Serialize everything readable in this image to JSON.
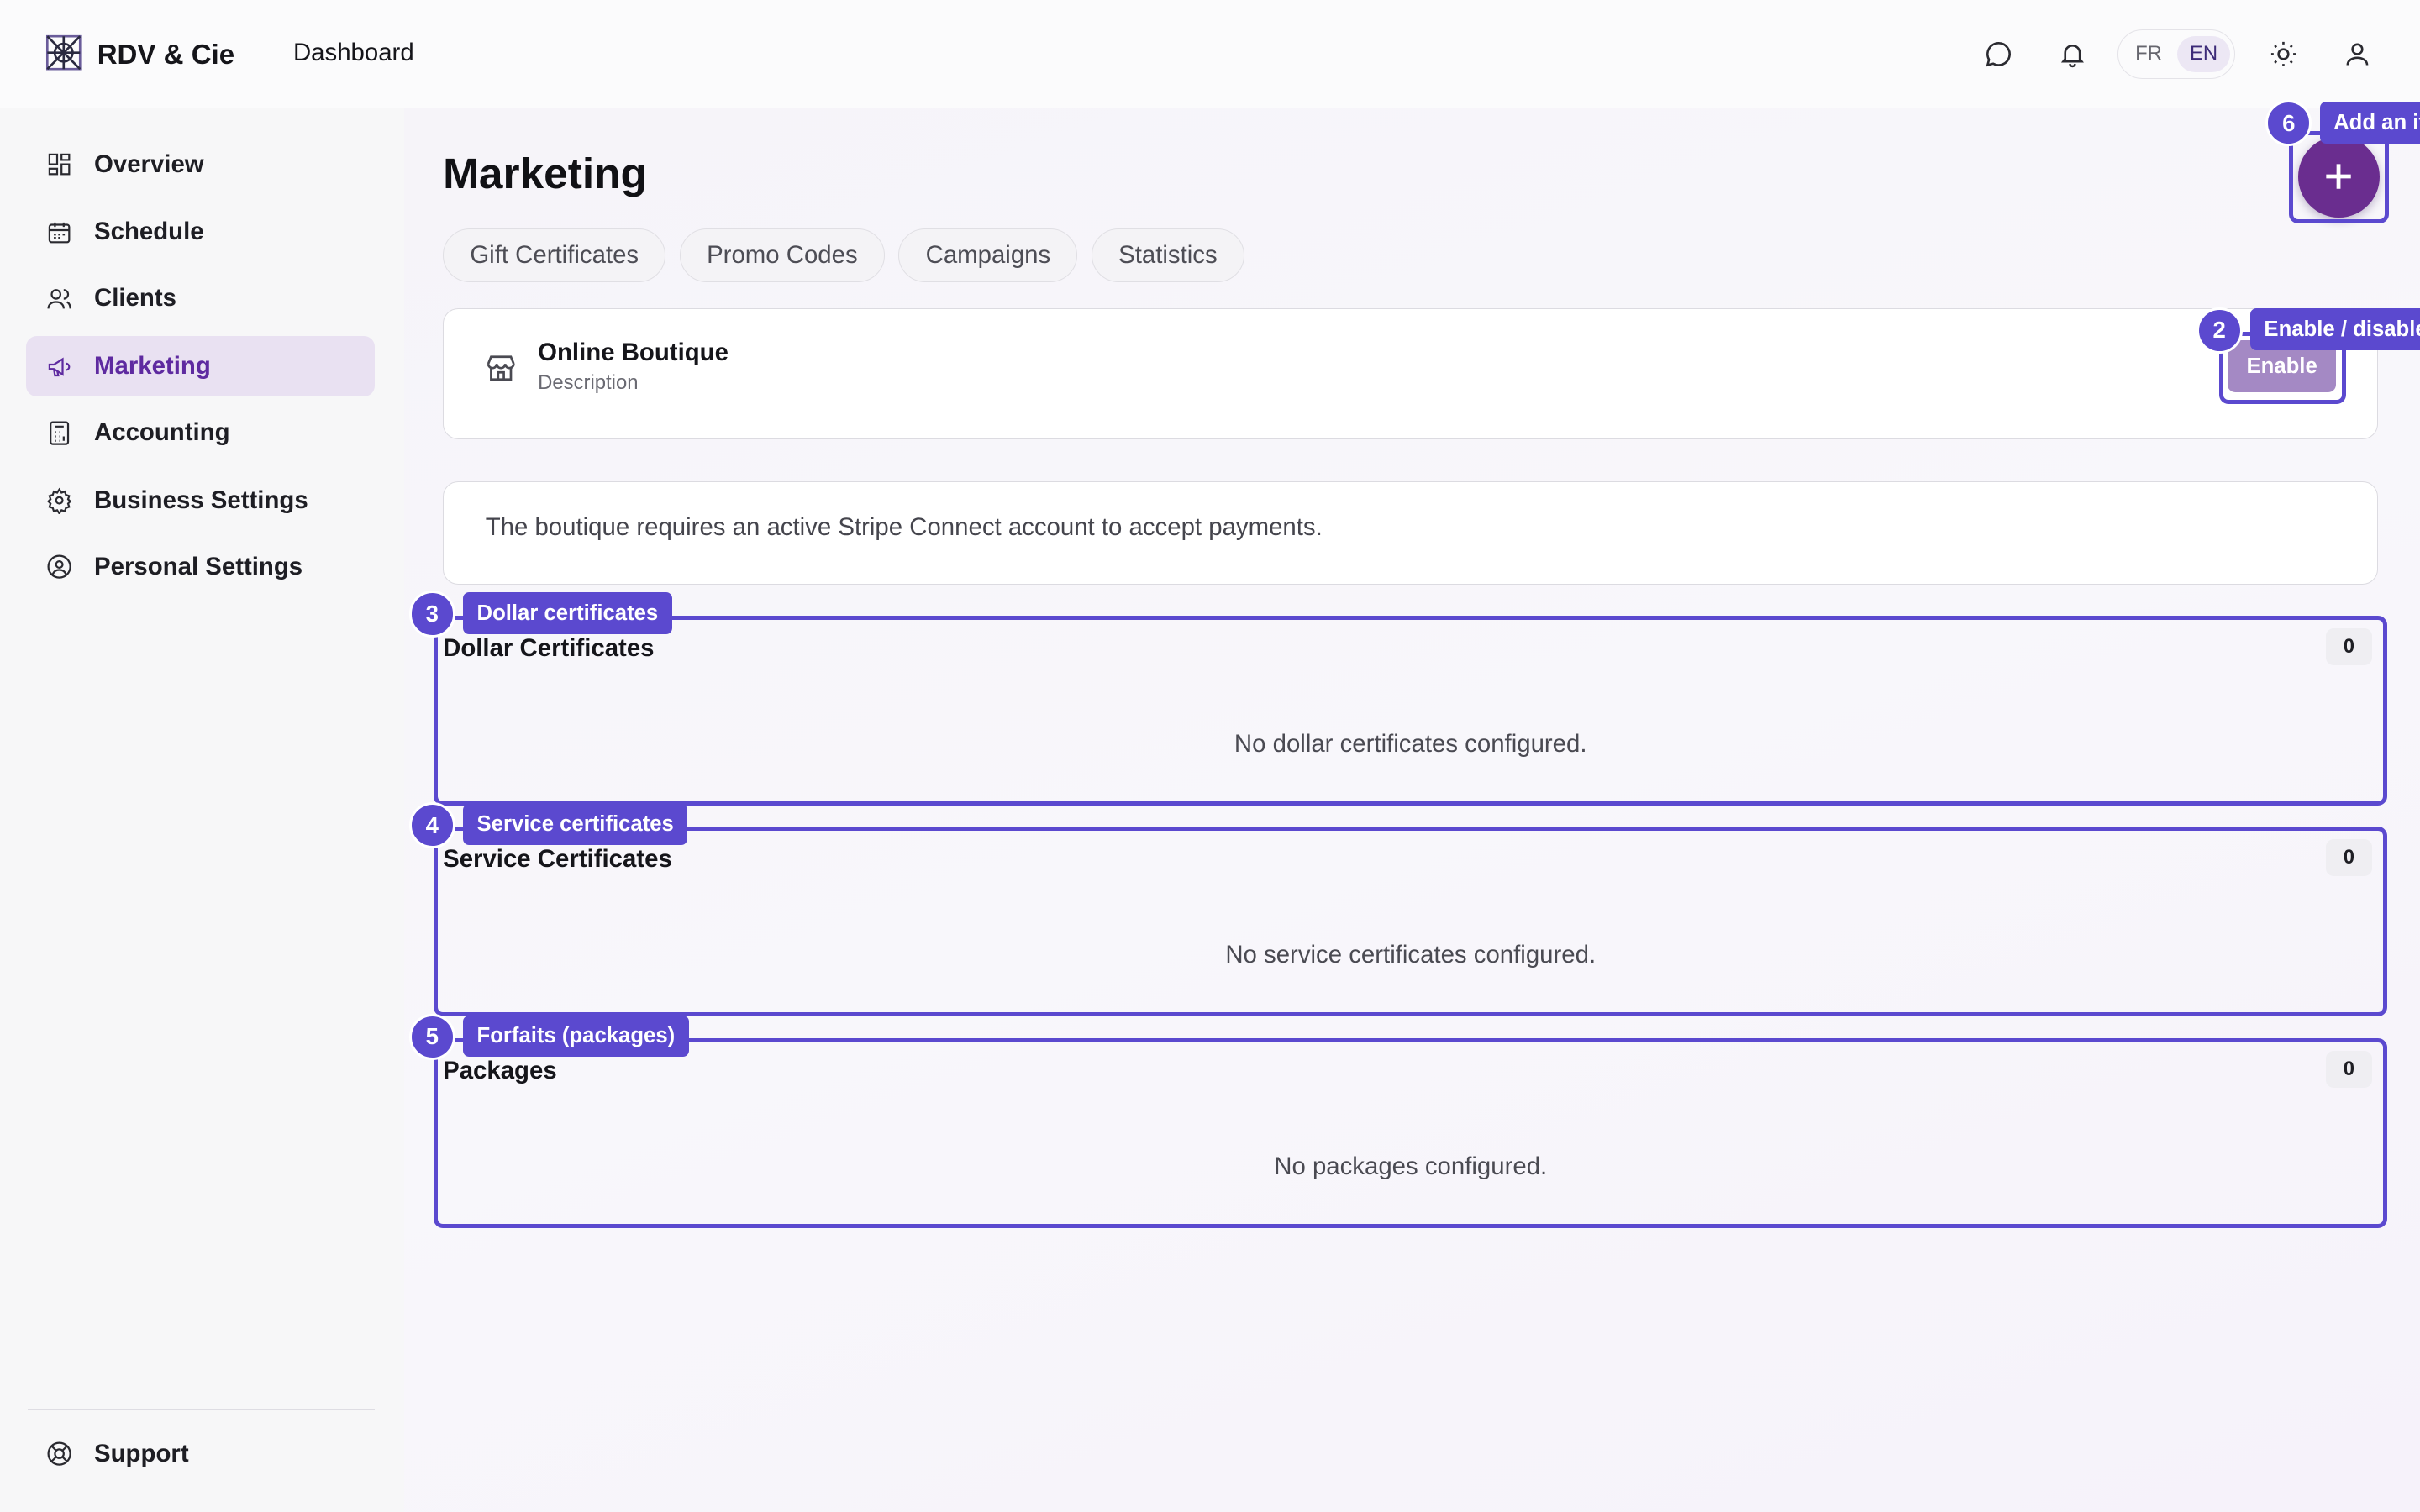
{
  "app": {
    "name": "RDV & Cie",
    "top_nav": "Dashboard"
  },
  "language": {
    "options": [
      "FR",
      "EN"
    ],
    "active": "EN"
  },
  "sidebar": {
    "items": [
      {
        "label": "Overview",
        "icon": "grid-icon"
      },
      {
        "label": "Schedule",
        "icon": "calendar-icon"
      },
      {
        "label": "Clients",
        "icon": "users-icon"
      },
      {
        "label": "Marketing",
        "icon": "megaphone-icon",
        "active": true
      },
      {
        "label": "Accounting",
        "icon": "calculator-icon"
      },
      {
        "label": "Business Settings",
        "icon": "gear-icon"
      },
      {
        "label": "Personal Settings",
        "icon": "user-circle-icon"
      }
    ],
    "footer": {
      "label": "Support",
      "icon": "lifebuoy-icon"
    }
  },
  "page": {
    "title": "Marketing",
    "tabs": [
      "Gift Certificates",
      "Promo Codes",
      "Campaigns",
      "Statistics"
    ]
  },
  "boutique": {
    "title": "Online Boutique",
    "description": "Description",
    "button": "Enable"
  },
  "notice": "The boutique requires an active Stripe Connect account to accept payments.",
  "sections": [
    {
      "title": "Dollar Certificates",
      "count": "0",
      "empty": "No dollar certificates configured."
    },
    {
      "title": "Service Certificates",
      "count": "0",
      "empty": "No service certificates configured."
    },
    {
      "title": "Packages",
      "count": "0",
      "empty": "No packages configured."
    }
  ],
  "tour": {
    "steps": [
      {
        "num": "2",
        "label": "Enable / disable"
      },
      {
        "num": "3",
        "label": "Dollar certificates"
      },
      {
        "num": "4",
        "label": "Service certificates"
      },
      {
        "num": "5",
        "label": "Forfaits (packages)"
      },
      {
        "num": "6",
        "label": "Add an item"
      }
    ]
  },
  "colors": {
    "accent": "#5b49cf",
    "brand_purple": "#6a2d8f",
    "active_nav_bg": "#e9e1f2"
  }
}
